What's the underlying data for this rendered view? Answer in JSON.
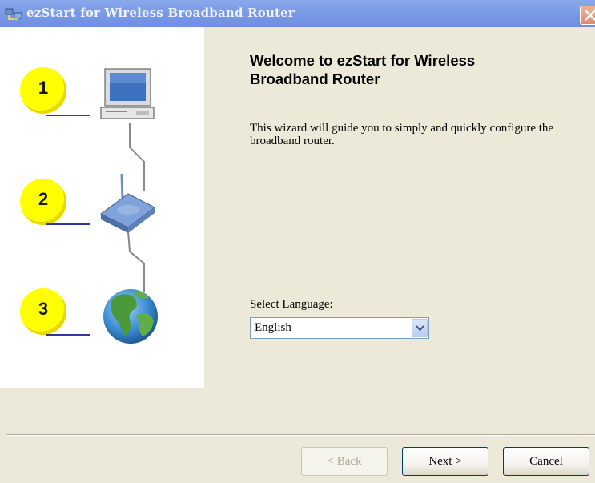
{
  "window": {
    "title": "ezStart for Wireless Broadband Router"
  },
  "steps": [
    {
      "number": "1",
      "icon": "computer-icon"
    },
    {
      "number": "2",
      "icon": "router-icon"
    },
    {
      "number": "3",
      "icon": "globe-icon"
    }
  ],
  "content": {
    "heading": "Welcome to ezStart for Wireless Broadband Router",
    "intro": "This wizard will guide you to simply and quickly configure the broadband router.",
    "language_label": "Select Language:",
    "language_selected": "English"
  },
  "buttons": {
    "back": "< Back",
    "next": "Next >",
    "cancel": "Cancel"
  },
  "colors": {
    "titlebar": "#7b9ae6",
    "dialog_bg": "#ece9d8",
    "badge": "#ffff00"
  }
}
